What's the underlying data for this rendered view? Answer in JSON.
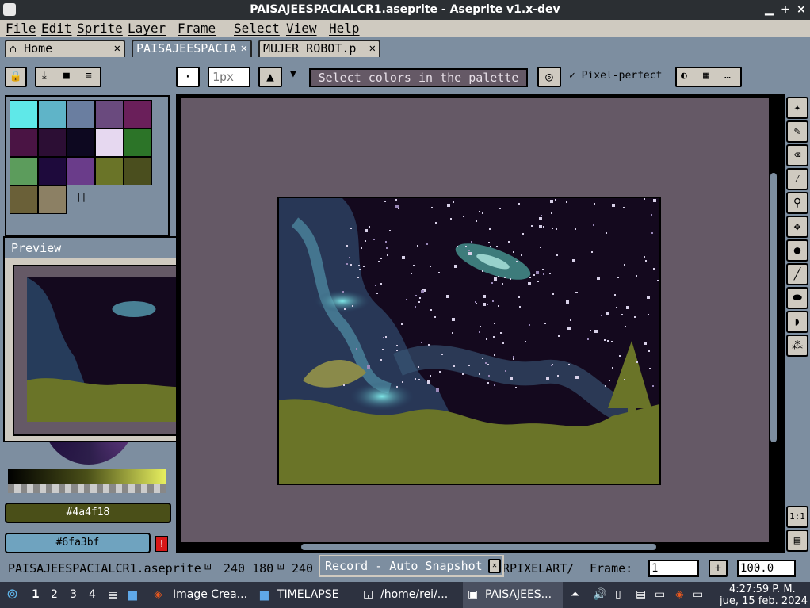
{
  "window": {
    "title": "PAISAJEESPACIALCR1.aseprite - Aseprite v1.x-dev"
  },
  "menu": [
    "File",
    "Edit",
    "Sprite",
    "Layer",
    "Frame",
    "Select",
    "View",
    "Help"
  ],
  "tabs": [
    {
      "label": "Home",
      "active": false
    },
    {
      "label": "PAISAJEESPACIA",
      "active": true
    },
    {
      "label": "MUJER ROBOT.p",
      "active": false
    }
  ],
  "toolbar": {
    "brush_size": "1px",
    "hint": "Select colors in the palette",
    "pixel_perfect": "Pixel-perfect"
  },
  "palette": {
    "colors": [
      "#5fe8e8",
      "#5fb4c8",
      "#6a7ea0",
      "#6a4a7e",
      "#6a1f5a",
      "#4a1444",
      "#2c0e34",
      "#0d0820",
      "#e6d8f0",
      "#2c7428",
      "#5c9c5c",
      "#1e0a3c",
      "#6a3c8a",
      "#6a7428",
      "#4a4e1e",
      "#6a6038",
      "#8c8064"
    ]
  },
  "preview": {
    "title": "Preview"
  },
  "colors": {
    "foreground": "#4a4f18",
    "background": "#6fa3bf"
  },
  "status": {
    "filename": "PAISAJEESPACIALCR1.aseprite",
    "size": "240 180",
    "size2": "240",
    "frame_label": "Frame:",
    "frame_value": "1",
    "zoom": "100.0",
    "layer_tail": "RPIXELART/"
  },
  "record": {
    "label": "Record - Auto Snapshot"
  },
  "taskbar": {
    "workspaces": [
      "1",
      "2",
      "3",
      "4"
    ],
    "apps": [
      "Image Crea...",
      "TIMELAPSE",
      "/home/rei/...",
      "PAISAJEES..."
    ],
    "time": "4:27:59 P. M.",
    "date": "jue, 15 feb. 2024"
  }
}
